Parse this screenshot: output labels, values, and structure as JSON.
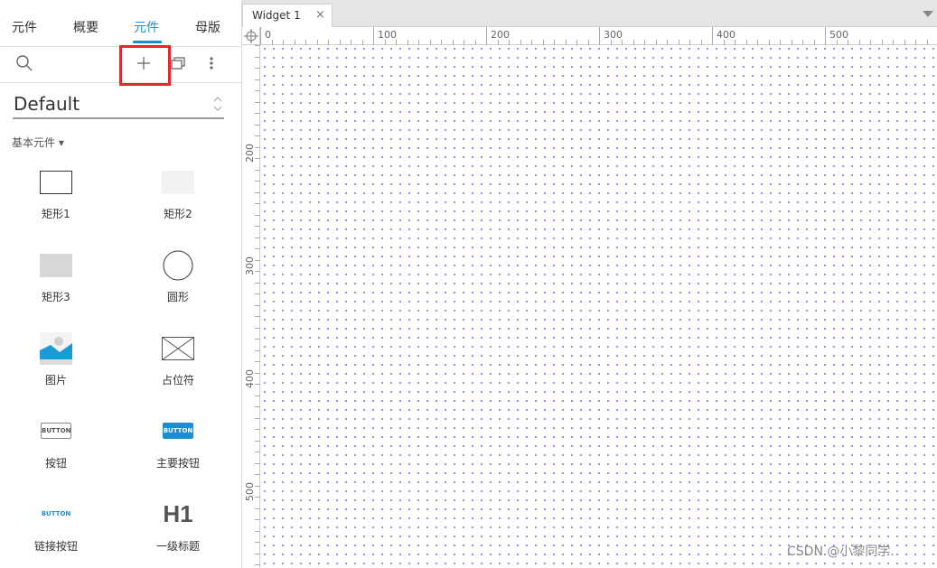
{
  "tabs": [
    {
      "label": "元件",
      "active": false
    },
    {
      "label": "概要",
      "active": false
    },
    {
      "label": "元件",
      "active": true
    },
    {
      "label": "母版",
      "active": false
    }
  ],
  "toolbar": {
    "icons": [
      "search-icon",
      "add-icon",
      "copy-icon",
      "more-icon"
    ]
  },
  "library": {
    "name": "Default"
  },
  "section": {
    "title": "基本元件 ▾"
  },
  "widgets": [
    {
      "label": "矩形1",
      "icon": "rectangle-outline-icon"
    },
    {
      "label": "矩形2",
      "icon": "rectangle-light-icon"
    },
    {
      "label": "矩形3",
      "icon": "rectangle-gray-icon"
    },
    {
      "label": "圆形",
      "icon": "circle-icon"
    },
    {
      "label": "图片",
      "icon": "image-icon"
    },
    {
      "label": "占位符",
      "icon": "placeholder-icon"
    },
    {
      "label": "按钮",
      "icon": "button-icon",
      "thumb_text": "BUTTON"
    },
    {
      "label": "主要按钮",
      "icon": "primary-button-icon",
      "thumb_text": "BUTTON"
    },
    {
      "label": "链接按钮",
      "icon": "link-button-icon",
      "thumb_text": "BUTTON"
    },
    {
      "label": "一级标题",
      "icon": "heading-icon",
      "thumb_text": "H1"
    }
  ],
  "document_tab": {
    "title": "Widget 1",
    "close": "×"
  },
  "ruler": {
    "top_labels": [
      "0",
      "100",
      "200",
      "300",
      "400",
      "500"
    ],
    "left_labels": [
      "200",
      "300",
      "400",
      "500"
    ]
  },
  "watermark": "CSDN @小黎同学.",
  "colors": {
    "accent": "#1a8fd6",
    "highlight": "#e8262d",
    "primary_button": "#1a8fd6",
    "grid_dot": "#6f7bd8"
  }
}
